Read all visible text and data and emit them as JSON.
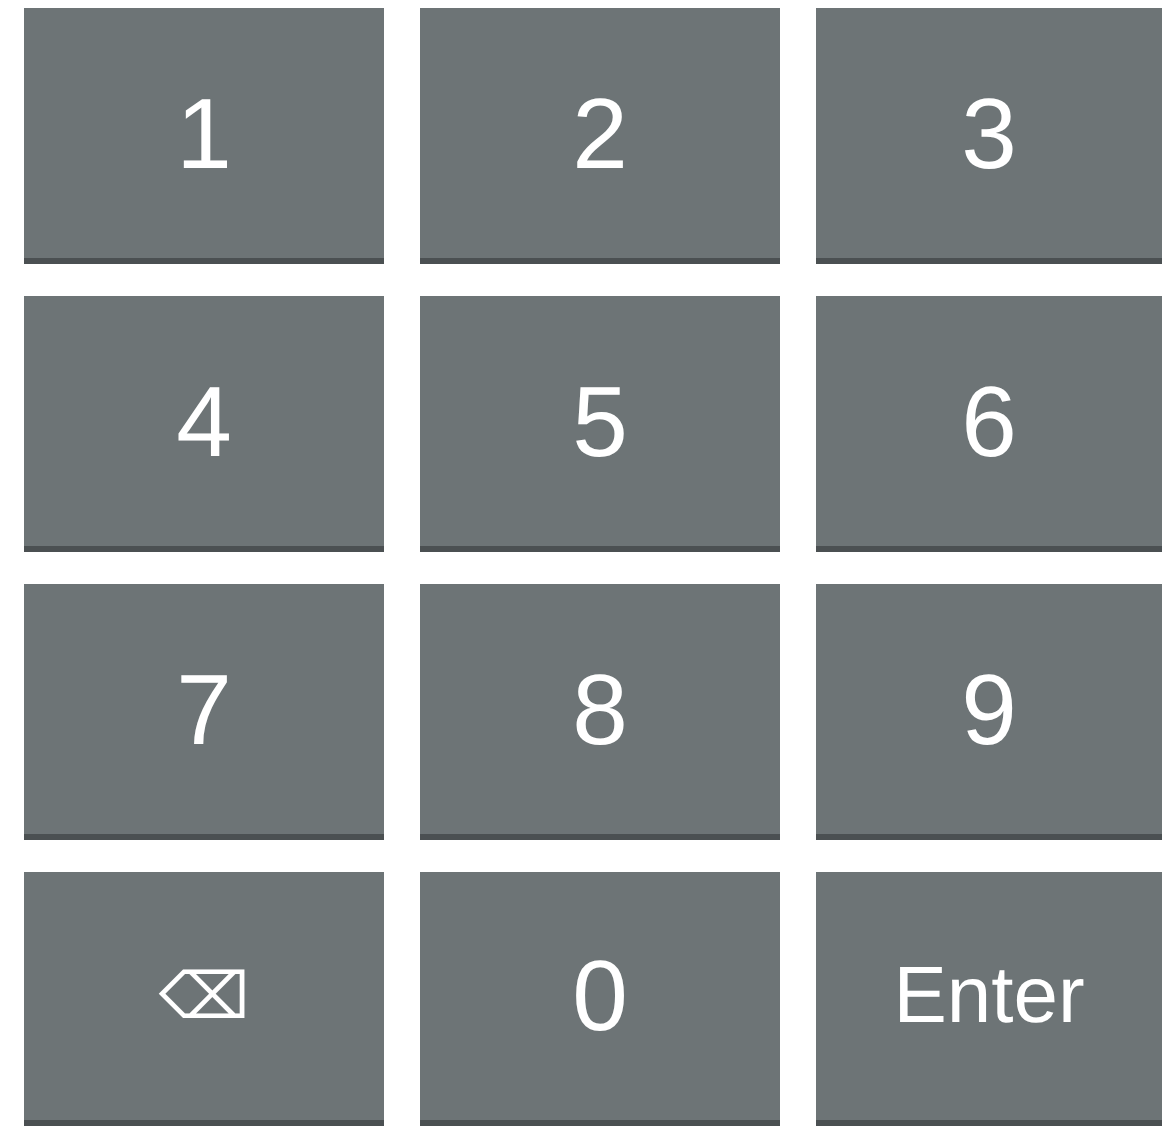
{
  "keys": [
    {
      "label": "1",
      "kind": "digit"
    },
    {
      "label": "2",
      "kind": "digit"
    },
    {
      "label": "3",
      "kind": "digit"
    },
    {
      "label": "4",
      "kind": "digit"
    },
    {
      "label": "5",
      "kind": "digit"
    },
    {
      "label": "6",
      "kind": "digit"
    },
    {
      "label": "7",
      "kind": "digit"
    },
    {
      "label": "8",
      "kind": "digit"
    },
    {
      "label": "9",
      "kind": "digit"
    },
    {
      "label": "⌫",
      "kind": "backspace"
    },
    {
      "label": "0",
      "kind": "digit"
    },
    {
      "label": "Enter",
      "kind": "enter"
    }
  ]
}
